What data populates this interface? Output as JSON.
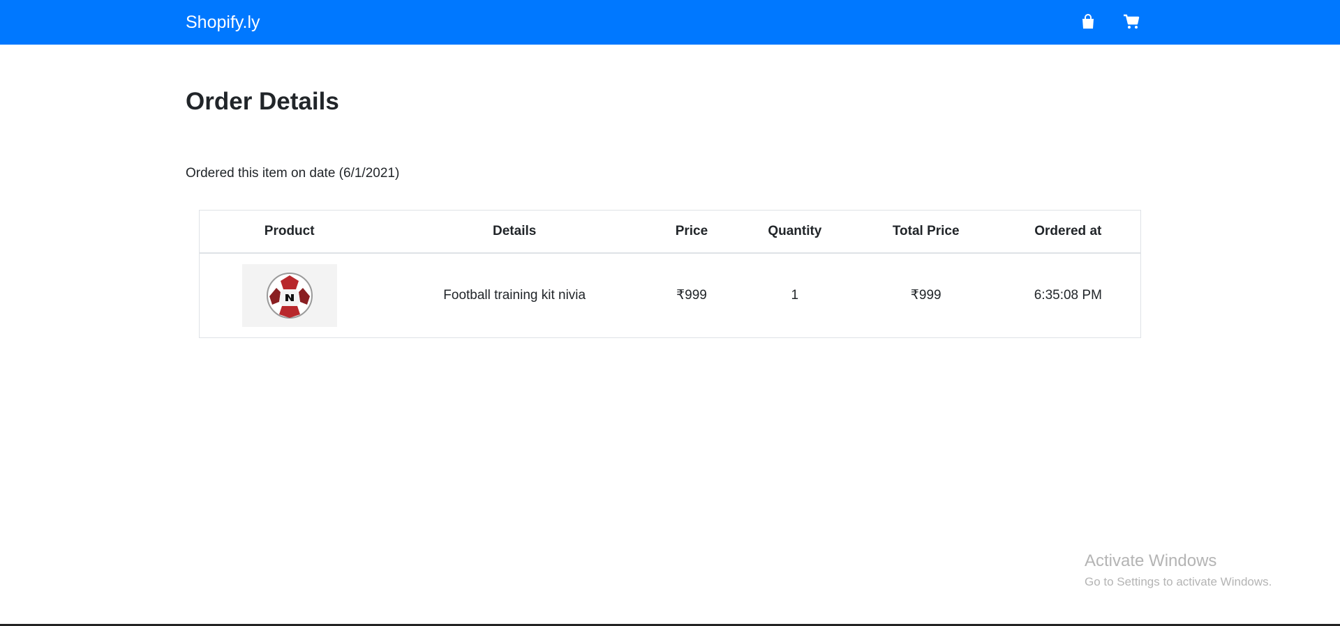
{
  "navbar": {
    "brand": "Shopify.ly",
    "bag_icon": "shopping-bag-icon",
    "cart_icon": "shopping-cart-icon",
    "color": "#0078ff"
  },
  "main": {
    "title": "Order Details",
    "order_date_text": "Ordered this item on date (6/1/2021)"
  },
  "table": {
    "headers": [
      "Product",
      "Details",
      "Price",
      "Quantity",
      "Total Price",
      "Ordered at"
    ],
    "rows": [
      {
        "product_image": "football-image",
        "details": "Football training kit nivia",
        "price": "₹999",
        "quantity": "1",
        "total_price": "₹999",
        "ordered_at": "6:35:08 PM"
      }
    ]
  },
  "watermark": {
    "title": "Activate Windows",
    "subtitle": "Go to Settings to activate Windows."
  }
}
